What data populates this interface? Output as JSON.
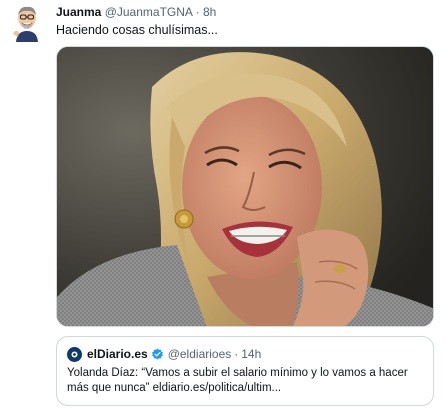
{
  "tweet": {
    "author_name": "Juanma",
    "author_handle": "@JuanmaTGNA",
    "separator": "·",
    "time": "8h",
    "text": "Haciendo cosas chulísimas..."
  },
  "quote": {
    "author_name": "elDiario.es",
    "author_handle": "@eldiarioes",
    "separator": "·",
    "time": "14h",
    "text": "Yolanda Díaz: “Vamos a subir el salario mínimo y lo vamos a hacer más que nunca” eldiario.es/politica/ultim..."
  },
  "colors": {
    "secondary_text": "#536471",
    "verified_badge": "#1d9bf0",
    "border": "#cfd9de"
  },
  "icons": {
    "verified": "verified-badge-icon",
    "quote_logo": "eldiario-logo-icon",
    "avatar": "cartoon-avatar-icon"
  }
}
